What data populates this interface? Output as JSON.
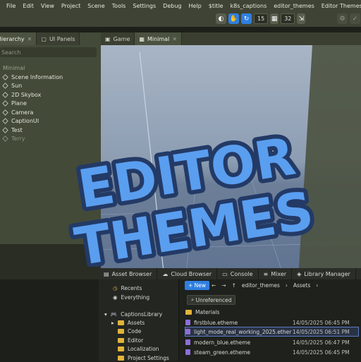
{
  "menubar": {
    "items": [
      "File",
      "Edit",
      "View",
      "Project",
      "Scene",
      "Tools",
      "Settings",
      "Debug",
      "Help",
      "$title",
      "k8s_captions",
      "editor_themes",
      "Editor Themes"
    ]
  },
  "toolbar": {
    "snap_value": "15",
    "grid_value": "32"
  },
  "hierarchy": {
    "tabs": [
      "Hierarchy",
      "UI Panels"
    ],
    "search_placeholder": "Search",
    "scene_name": "Minimal",
    "nodes": [
      "Scene Information",
      "Sun",
      "2D Skybox",
      "Plane",
      "Camera",
      "CaptionUI",
      "Test",
      "Terry"
    ]
  },
  "viewport": {
    "tabs": [
      "Game",
      "Minimal"
    ]
  },
  "overlay": {
    "line1": "EDITOR",
    "line2": "THEMES"
  },
  "bottom": {
    "tabs": [
      "Asset Browser",
      "Cloud Browser",
      "Console",
      "Mixer",
      "Library Manager"
    ],
    "side": {
      "recents": "Recents",
      "everything": "Everything",
      "library": "CaptionsLibrary",
      "folders": [
        "Assets",
        "Code",
        "Editor",
        "Localization",
        "Project Settings"
      ]
    },
    "new_label": "New",
    "breadcrumb": [
      "editor_themes",
      "Assets"
    ],
    "filter_label": "Unreferenced",
    "files": [
      {
        "name": "Materials",
        "date": ""
      },
      {
        "name": "firstblue.etheme",
        "date": "14/05/2025 06:45 PM"
      },
      {
        "name": "light_mode_real_working_2025.ether",
        "date": "14/05/2025 06:51 PM"
      },
      {
        "name": "modern_blue.etheme",
        "date": "14/05/2025 06:47 PM"
      },
      {
        "name": "steam_green.etheme",
        "date": "14/05/2025 06:45 PM"
      }
    ]
  },
  "colors": {
    "accent": "#2f7fe0",
    "title_fill": "#5a9ef0",
    "title_stroke": "#233a66"
  }
}
